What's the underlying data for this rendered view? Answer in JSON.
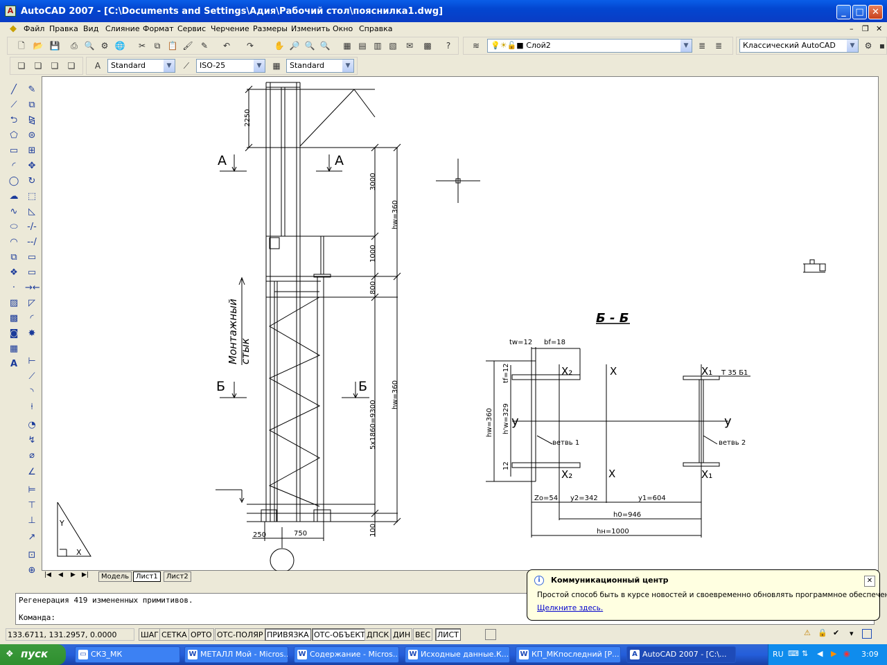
{
  "window": {
    "title": "AutoCAD 2007 - [C:\\Documents and Settings\\Адия\\Рабочий стол\\пояснилка1.dwg]",
    "app_icon": "autocad-icon",
    "controls": [
      "minimize",
      "maximize",
      "close"
    ]
  },
  "menu": {
    "items": [
      "Файл",
      "Правка",
      "Вид",
      "Слияние",
      "Формат",
      "Сервис",
      "Черчение",
      "Размеры",
      "Изменить",
      "Окно",
      "Справка"
    ]
  },
  "toolbar": {
    "layer_combo": "Слой2",
    "workspace_combo": "Классический AutoCAD",
    "text_style_combo": "Standard",
    "dim_style_combo": "ISO-25",
    "table_style_combo": "Standard"
  },
  "drawing": {
    "section_aa_left": "А",
    "section_aa_right": "А",
    "section_bb_left": "Б",
    "section_bb_right": "Б",
    "dim_2250": "2250",
    "dim_3000": "3000",
    "dim_1000": "1000",
    "dim_800": "800",
    "dim_hw360_top": "hw=360",
    "dim_hw360_bottom": "hw=360",
    "dim_5x1860": "5x1860=9300",
    "dim_100": "100",
    "dim_250": "250",
    "dim_750": "750",
    "montage_line1": "Монтажный",
    "montage_line2": "стык",
    "section_title": "Б - Б",
    "tw": "tw=12",
    "bf": "bf=18",
    "tf": "tf=12",
    "hw": "hw=360",
    "hprime": "h'w=329",
    "dim_12": "12",
    "x2_top": "X₂",
    "x_top": "X",
    "x1_top": "X₁",
    "t35": "T 35 Б1",
    "y_left": "у",
    "y_right": "у",
    "branch1": "ветвь 1",
    "branch2": "ветвь 2",
    "x2_bot": "X₂",
    "x_bot": "X",
    "x1_bot": "X₁",
    "zo": "Zo=54",
    "y2": "y2=342",
    "y1": "y1=604",
    "h0": "h0=946",
    "hn": "hн=1000",
    "ucs_y": "Y",
    "ucs_x": "X"
  },
  "layout_tabs": [
    "Модель",
    "Лист1",
    "Лист2"
  ],
  "command_line": {
    "history": "Регенерация 419 измененных примитивов.",
    "prompt": "Команда:"
  },
  "status": {
    "coords": "133.6711, 131.2957, 0.0000",
    "toggles": [
      {
        "label": "ШАГ",
        "on": false
      },
      {
        "label": "СЕТКА",
        "on": false
      },
      {
        "label": "ОРТО",
        "on": false
      },
      {
        "label": "ОТС-ПОЛЯР",
        "on": false
      },
      {
        "label": "ПРИВЯЗКА",
        "on": true
      },
      {
        "label": "ОТС-ОБЪЕКТ",
        "on": true
      },
      {
        "label": "ДПСК",
        "on": false
      },
      {
        "label": "ДИН",
        "on": false
      },
      {
        "label": "ВЕС",
        "on": false
      },
      {
        "label": "ЛИСТ",
        "on": true
      }
    ]
  },
  "balloon": {
    "title": "Коммуникационный центр",
    "text": "Простой способ быть в курсе новостей и своевременно обновлять программное обеспечение.",
    "link": "Щелкните здесь."
  },
  "taskbar": {
    "start": "пуск",
    "tasks": [
      "СКЗ_МК",
      "МЕТАЛЛ Мой - Micros...",
      "Содержание - Micros...",
      "Исходные данные.К...",
      "КП_МКпоследний [Р...",
      "AutoCAD 2007 - [C:\\..."
    ],
    "lang": "RU",
    "clock": "3:09"
  }
}
